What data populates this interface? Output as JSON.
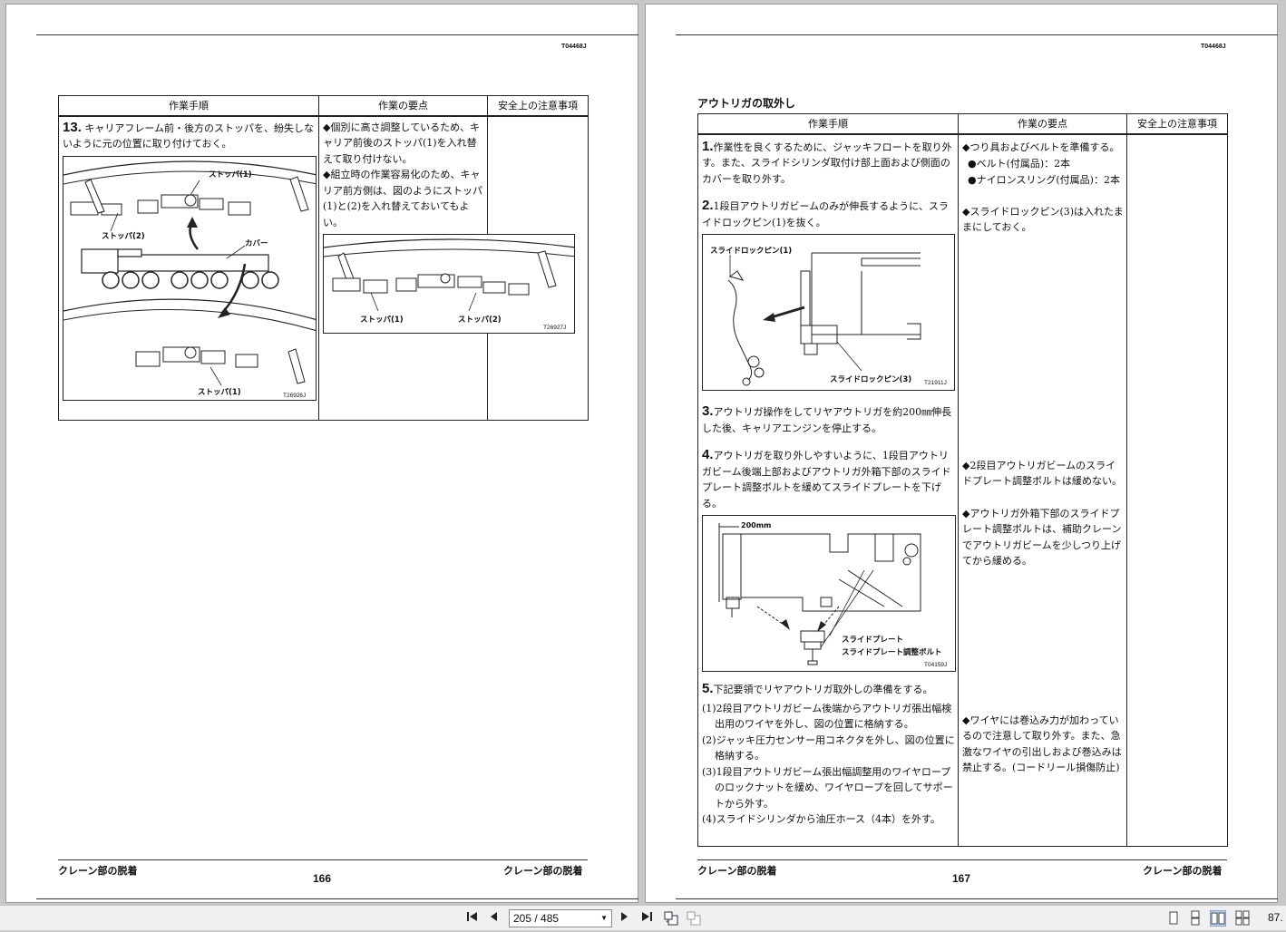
{
  "left_page": {
    "doc_code": "T04468J",
    "headers": [
      "作業手順",
      "作業の要点",
      "安全上の注意事項"
    ],
    "step13": {
      "num": "13.",
      "text": "キャリアフレーム前・後方のストッパを、紛失しないように元の位置に取り付けておく。",
      "points": [
        "◆個別に高さ調整しているため、キャリア前後のストッパ(1)を入れ替えて取り付けない。",
        "◆組立時の作業容易化のため、キャリア前方側は、図のようにストッパ(1)と(2)を入れ替えておいてもよい。"
      ],
      "fig1": {
        "stopper1_top": "ストッパ(1)",
        "stopper2": "ストッパ(2)",
        "cover": "カバー",
        "stopper1_bottom": "ストッパ(1)",
        "code": "T26926J"
      },
      "fig2": {
        "stopper1": "ストッパ(1)",
        "stopper2": "ストッパ(2)",
        "code": "T26927J"
      }
    },
    "footer_left": "クレーン部の脱着",
    "footer_right": "クレーン部の脱着",
    "page_number": "166"
  },
  "right_page": {
    "doc_code": "T04468J",
    "section_title": "アウトリガの取外し",
    "headers": [
      "作業手順",
      "作業の要点",
      "安全上の注意事項"
    ],
    "steps": [
      {
        "num": "1.",
        "text": "作業性を良くするために、ジャッキフロートを取り外す。また、スライドシリンダ取付け部上面および側面のカバーを取り外す。"
      },
      {
        "num": "2.",
        "text": "1段目アウトリガビームのみが伸長するように、スライドロックピン(1)を抜く。"
      },
      {
        "num": "3.",
        "text": "アウトリガ操作をしてリヤアウトリガを約200㎜伸長した後、キャリアエンジンを停止する。"
      },
      {
        "num": "4.",
        "text": "アウトリガを取り外しやすいように、1段目アウトリガビーム後端上部およびアウトリガ外箱下部のスライドプレート調整ボルトを緩めてスライドプレートを下げる。"
      },
      {
        "num": "5.",
        "text": "下記要領でリヤアウトリガ取外しの準備をする。"
      }
    ],
    "step5_subs": [
      "(1)2段目アウトリガビーム後端からアウトリガ張出幅検出用のワイヤを外し、図の位置に格納する。",
      "(2)ジャッキ圧力センサー用コネクタを外し、図の位置に格納する。",
      "(3)1段目アウトリガビーム張出幅調整用のワイヤロープのロックナットを緩め、ワイヤロープを回してサポートから外す。",
      "(4)スライドシリンダから油圧ホース（4本）を外す。"
    ],
    "points": {
      "p1": "◆つり具およびベルトを準備する。",
      "p1_belt": "●ベルト(付属品)：2本",
      "p1_sling": "●ナイロンスリング(付属品)：2本",
      "p2": "◆スライドロックピン(3)は入れたままにしておく。",
      "p4a": "◆2段目アウトリガビームのスライドプレート調整ボルトは緩めない。",
      "p4b": "◆アウトリガ外箱下部のスライドプレート調整ボルトは、補助クレーンでアウトリガビームを少しつり上げてから緩める。",
      "p5": "◆ワイヤには巻込み力が加わっているので注意して取り外す。また、急激なワイヤの引出しおよび巻込みは禁止する。(コードリール損傷防止)"
    },
    "fig_step2": {
      "pin1": "スライドロックピン(1)",
      "pin3": "スライドロックピン(3)",
      "code": "T21911J"
    },
    "fig_step4": {
      "dim": "200mm",
      "plate": "スライドプレート",
      "bolt": "スライドプレート調整ボルト",
      "code": "T04159J"
    },
    "footer_left": "クレーン部の脱着",
    "footer_right": "クレーン部の脱着",
    "page_number": "167"
  },
  "toolbar": {
    "page_field": "205 / 485",
    "zoom": "87."
  }
}
